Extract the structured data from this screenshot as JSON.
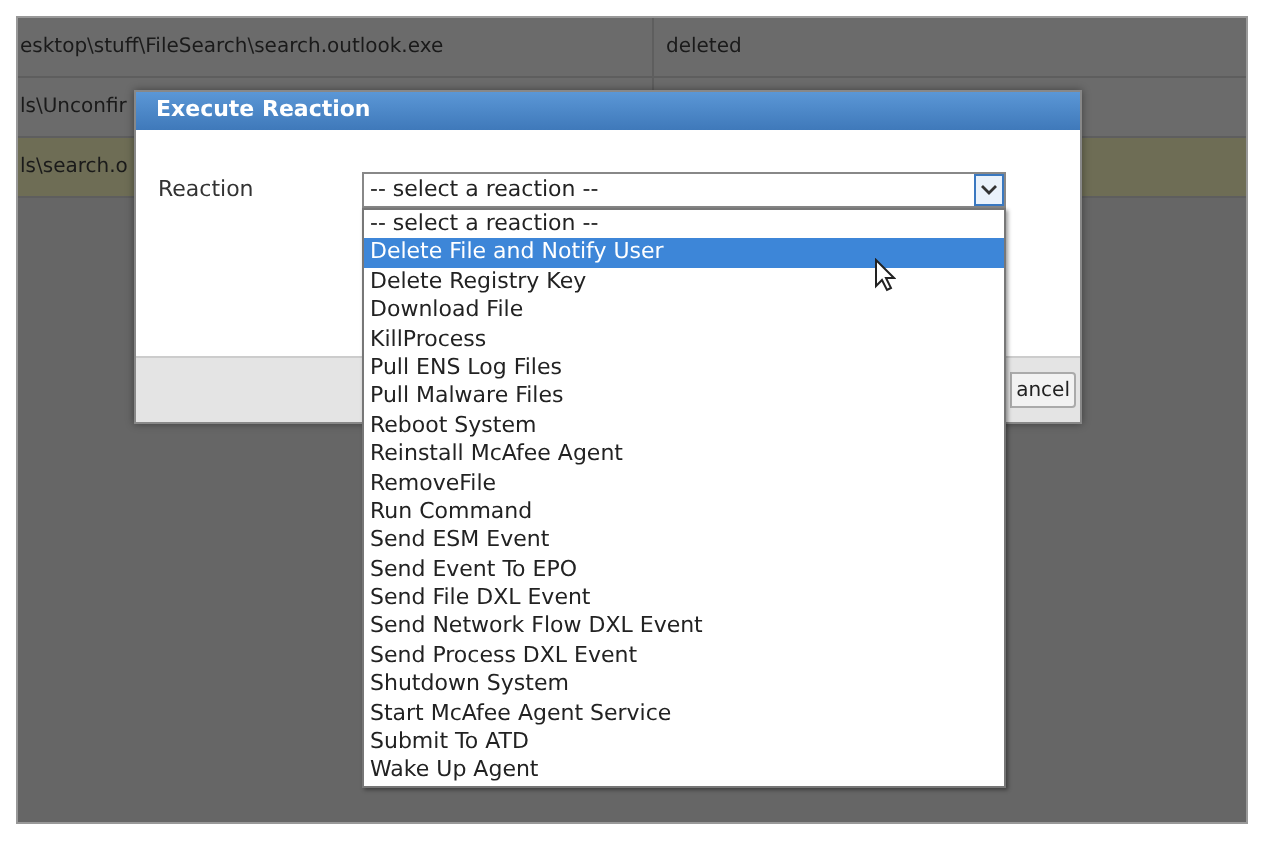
{
  "table": {
    "rows": [
      {
        "cells": [
          "esktop\\stuff\\FileSearch\\search.outlook.exe",
          "deleted"
        ],
        "highlighted": false
      },
      {
        "cells": [
          "ls\\Unconfir"
        ],
        "highlighted": false
      },
      {
        "cells": [
          "ls\\search.o"
        ],
        "highlighted": true
      }
    ]
  },
  "dialog": {
    "title": "Execute Reaction",
    "field": {
      "label": "Reaction",
      "value": "-- select a reaction --",
      "expanded": true
    },
    "options": [
      {
        "label": "-- select a reaction --",
        "selected": false
      },
      {
        "label": "Delete File and Notify User",
        "selected": true
      },
      {
        "label": "Delete Registry Key",
        "selected": false
      },
      {
        "label": "Download File",
        "selected": false
      },
      {
        "label": "KillProcess",
        "selected": false
      },
      {
        "label": "Pull ENS Log Files",
        "selected": false
      },
      {
        "label": "Pull Malware Files",
        "selected": false
      },
      {
        "label": "Reboot System",
        "selected": false
      },
      {
        "label": "Reinstall McAfee Agent",
        "selected": false
      },
      {
        "label": "RemoveFile",
        "selected": false
      },
      {
        "label": "Run Command",
        "selected": false
      },
      {
        "label": "Send ESM Event",
        "selected": false
      },
      {
        "label": "Send Event To EPO",
        "selected": false
      },
      {
        "label": "Send File DXL Event",
        "selected": false
      },
      {
        "label": "Send Network Flow DXL Event",
        "selected": false
      },
      {
        "label": "Send Process DXL Event",
        "selected": false
      },
      {
        "label": "Shutdown System",
        "selected": false
      },
      {
        "label": "Start McAfee Agent Service",
        "selected": false
      },
      {
        "label": "Submit To ATD",
        "selected": false
      },
      {
        "label": "Wake Up Agent",
        "selected": false
      }
    ],
    "buttons": [
      "ancel"
    ]
  }
}
